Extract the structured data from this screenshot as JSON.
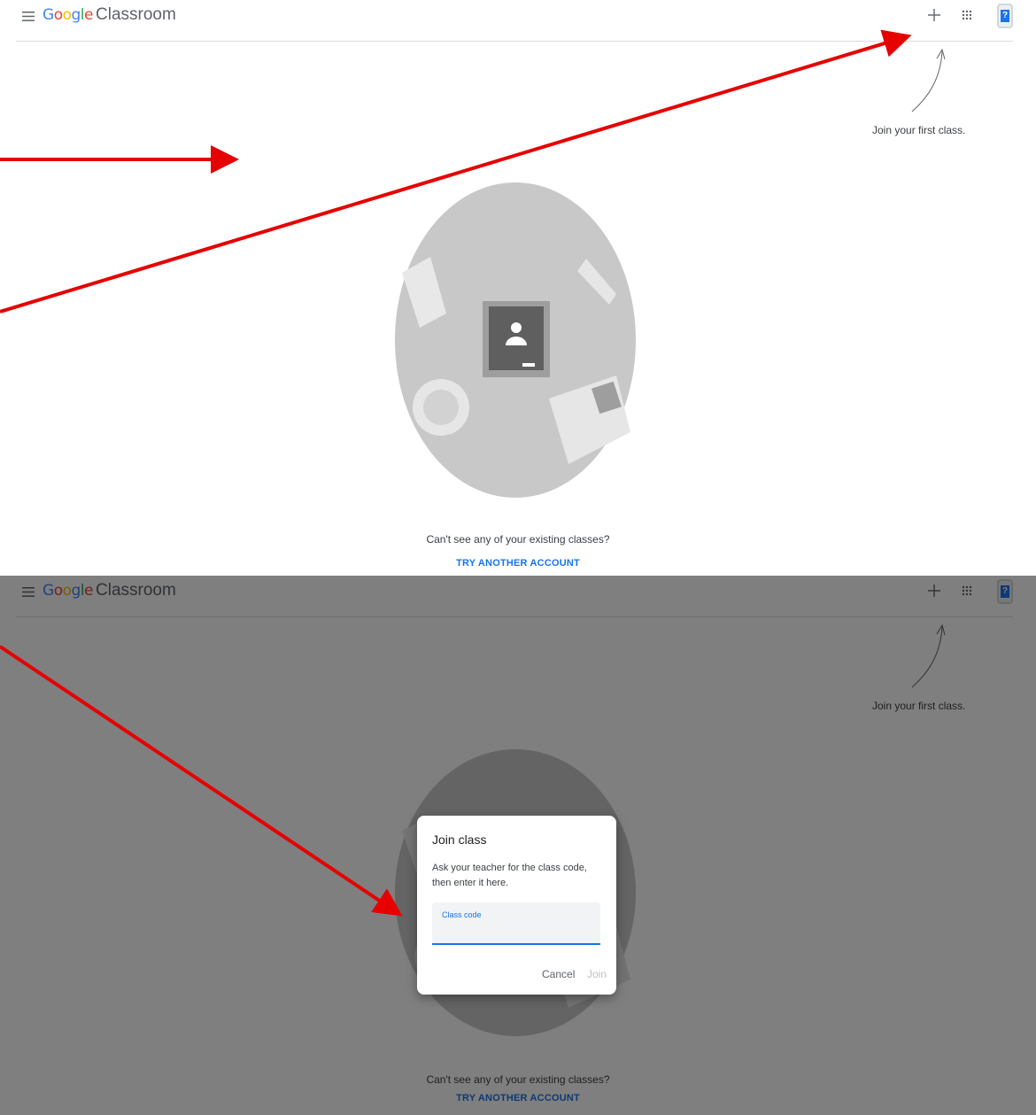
{
  "app": {
    "brand_letters": [
      {
        "char": "G",
        "color": "#4285F4"
      },
      {
        "char": "o",
        "color": "#EA4335"
      },
      {
        "char": "o",
        "color": "#FBBC05"
      },
      {
        "char": "g",
        "color": "#4285F4"
      },
      {
        "char": "l",
        "color": "#34A853"
      },
      {
        "char": "e",
        "color": "#EA4335"
      }
    ],
    "product_name": "Classroom",
    "avatar_glyph": "?"
  },
  "icons": {
    "menu": "hamburger-icon",
    "add": "plus-icon",
    "apps": "grid-apps-icon",
    "account": "account-avatar-icon"
  },
  "home": {
    "hint": "Join your first class.",
    "no_classes_text": "Can't see any of your existing classes?",
    "try_account_link": "TRY ANOTHER ACCOUNT"
  },
  "join_dialog": {
    "title": "Join class",
    "description": "Ask your teacher for the class code, then enter it here.",
    "field_label": "Class code",
    "field_value": "",
    "cancel_label": "Cancel",
    "join_label": "Join"
  },
  "colors": {
    "accent": "#1a73e8",
    "annotation_arrow": "#e60000",
    "scrim": "rgba(0,0,0,0.5)"
  }
}
